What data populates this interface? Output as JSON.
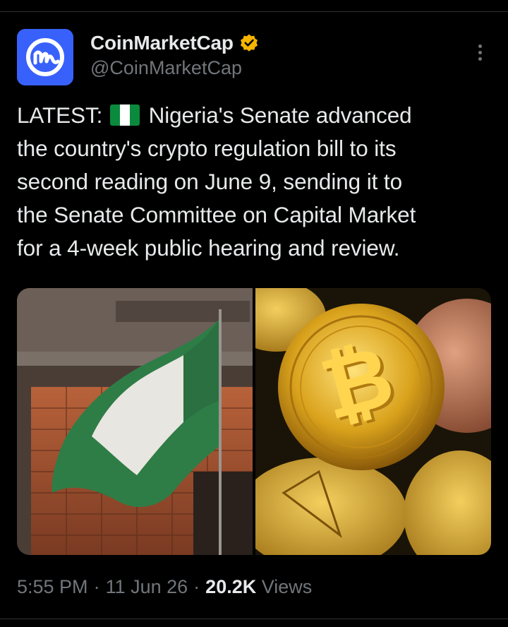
{
  "author": {
    "display_name": "CoinMarketCap",
    "handle": "@CoinMarketCap",
    "verified_badge_color": "#f7b500",
    "avatar_color": "#3861fb"
  },
  "tweet": {
    "prefix": "LATEST:",
    "flag_icon": "nigeria-flag-emoji",
    "line1": "Nigeria's Senate advanced",
    "line2": "the country's crypto regulation bill to its",
    "line3": "second reading on June 9, sending it to",
    "line4": "the Senate Committee on Capital Market",
    "line5": "for a 4-week public hearing and review."
  },
  "media": [
    {
      "name": "nigerian-flag-photo",
      "icon": "flag-photo"
    },
    {
      "name": "bitcoin-coins-photo",
      "icon": "bitcoin-photo"
    }
  ],
  "meta": {
    "time": "5:55 PM",
    "date": "11 Jun 26",
    "separator": "·",
    "views_count": "20.2K",
    "views_label": "Views"
  },
  "colors": {
    "background": "#000000",
    "text": "#e7e9ea",
    "secondary": "#71767b",
    "divider": "#2f3336"
  }
}
